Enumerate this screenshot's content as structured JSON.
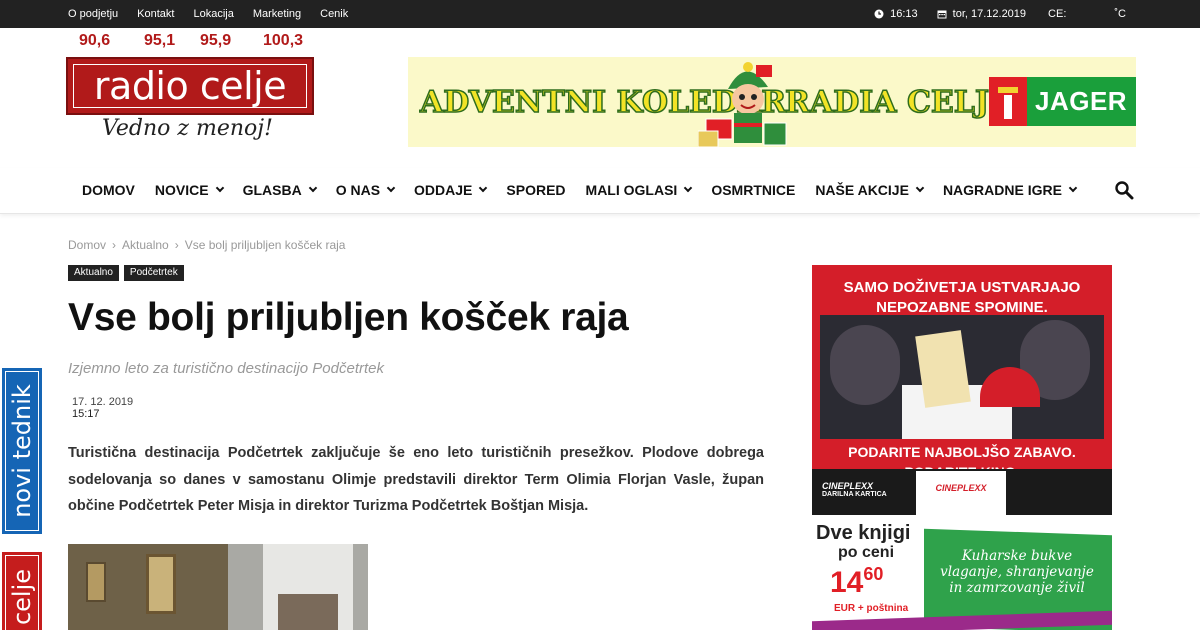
{
  "topbar": {
    "nav": [
      "O podjetju",
      "Kontakt",
      "Lokacija",
      "Marketing",
      "Cenik"
    ],
    "time": "16:13",
    "date": "tor, 17.12.2019",
    "city": "CE:",
    "temp_unit": "˚C"
  },
  "header": {
    "frequencies": [
      "90,6",
      "95,1",
      "95,9",
      "100,3"
    ],
    "logo_text": "radio celje",
    "slogan": "Vedno z menoj!",
    "banner": {
      "text_left": "ADVENTNI KOLEDAR",
      "text_right": "RADIA CELJE!",
      "sponsor": "JAGER"
    }
  },
  "mainnav": {
    "items": [
      {
        "label": "DOMOV",
        "dropdown": false
      },
      {
        "label": "NOVICE",
        "dropdown": true
      },
      {
        "label": "GLASBA",
        "dropdown": true
      },
      {
        "label": "O NAS",
        "dropdown": true
      },
      {
        "label": "ODDAJE",
        "dropdown": true
      },
      {
        "label": "SPORED",
        "dropdown": false
      },
      {
        "label": "MALI OGLASI",
        "dropdown": true
      },
      {
        "label": "OSMRTNICE",
        "dropdown": false
      },
      {
        "label": "NAŠE AKCIJE",
        "dropdown": true
      },
      {
        "label": "NAGRADNE IGRE",
        "dropdown": true
      }
    ]
  },
  "breadcrumb": {
    "home": "Domov",
    "category": "Aktualno",
    "current": "Vse bolj priljubljen košček raja",
    "separator": "›"
  },
  "article": {
    "tags": [
      "Aktualno",
      "Podčetrtek"
    ],
    "title": "Vse bolj priljubljen košček raja",
    "subtitle": "Izjemno leto za turistično destinacijo Podčetrtek",
    "date": "17. 12. 2019",
    "time": "15:17",
    "lead": "Turistična destinacija Podčetrtek zaključuje še eno leto turističnih presežkov. Plodove dobrega sodelovanja so danes v samostanu Olimje predstavili direktor Term Olimia Florjan Vasle, župan občine Podčetrtek Peter Misja in direktor Turizma Podčetrtek Boštjan Misja."
  },
  "side": {
    "tab1": "novi tednik",
    "tab2": "celje"
  },
  "ads": {
    "cineplexx": {
      "top_line1": "SAMO DOŽIVETJA USTVARJAJO",
      "top_line2": "NEPOZABNE SPOMINE.",
      "mid_line1": "PODARITE NAJBOLJŠO ZABAVO.",
      "mid_line2": "PODARITE KINO.",
      "card_label": "CINEPLEXX",
      "card_sub": "DARILNA KARTICA",
      "card2": "CINEPLEXX"
    },
    "books": {
      "headline": "Dve knjigi",
      "subhead": "po ceni",
      "price_main": "14",
      "price_cents": "60",
      "price_note": "EUR + poštnina",
      "book_title": "Kuharske bukve vlaganje, shranjevanje in zamrzovanje živil"
    }
  },
  "colors": {
    "brand_red": "#b11a1a",
    "topbar_bg": "#222222",
    "novi_tednik_blue": "#1565b5",
    "jager_green": "#1a9f3b"
  }
}
